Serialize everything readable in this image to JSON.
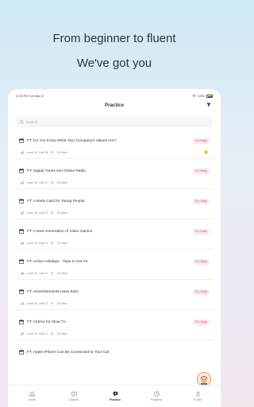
{
  "hero": {
    "line1": "From beginner to fluent",
    "line2": "We've got you"
  },
  "status": {
    "time": "12:09 PM  Tue May 12",
    "battery": "100%"
  },
  "header": {
    "title": "Practice"
  },
  "search": {
    "placeholder": "Search"
  },
  "lessons": [
    {
      "title": "FT: Do You Know What Your Company's Values Are?",
      "level": "Level 10, Unit 38",
      "duration": "30 Mins",
      "badge": "For Today",
      "play": true
    },
    {
      "title": "FT: Digital Tunes into Online Radio",
      "level": "Level 10, Unit 37",
      "duration": "30 Mins",
      "badge": "For Today"
    },
    {
      "title": "FT: A Bank Card for Young People",
      "level": "Level 10, Unit 37",
      "duration": "30 Mins",
      "badge": "For Today"
    },
    {
      "title": "FT: A New Generation of Video Games",
      "level": "Level 10, Unit 37",
      "duration": "30 Mins",
      "badge": "For Today"
    },
    {
      "title": "FT: Active Holidays - Trips to Get Fit",
      "level": "Level 10, Unit 37",
      "duration": "30 Mins",
      "badge": "For Today"
    },
    {
      "title": "FT: Advertisements Have Ears",
      "level": "Level 10, Unit 37",
      "duration": "30 Mins",
      "badge": "For Today"
    },
    {
      "title": "FT: Airtime for Slow TV",
      "level": "Level 10, Unit 37",
      "duration": "30 Mins",
      "badge": "For Today"
    },
    {
      "title": "FT: Apple iPhone Can Be Connected to Your Car",
      "level": "",
      "duration": "",
      "badge": ""
    }
  ],
  "tabs": [
    {
      "label": "Home"
    },
    {
      "label": "Classes"
    },
    {
      "label": "Practice"
    },
    {
      "label": "Progress"
    },
    {
      "label": "Profile"
    }
  ],
  "colors": {
    "badge_bg": "#fde6ee",
    "badge_text": "#d6537c",
    "accent_orange": "#ff8a3c"
  }
}
